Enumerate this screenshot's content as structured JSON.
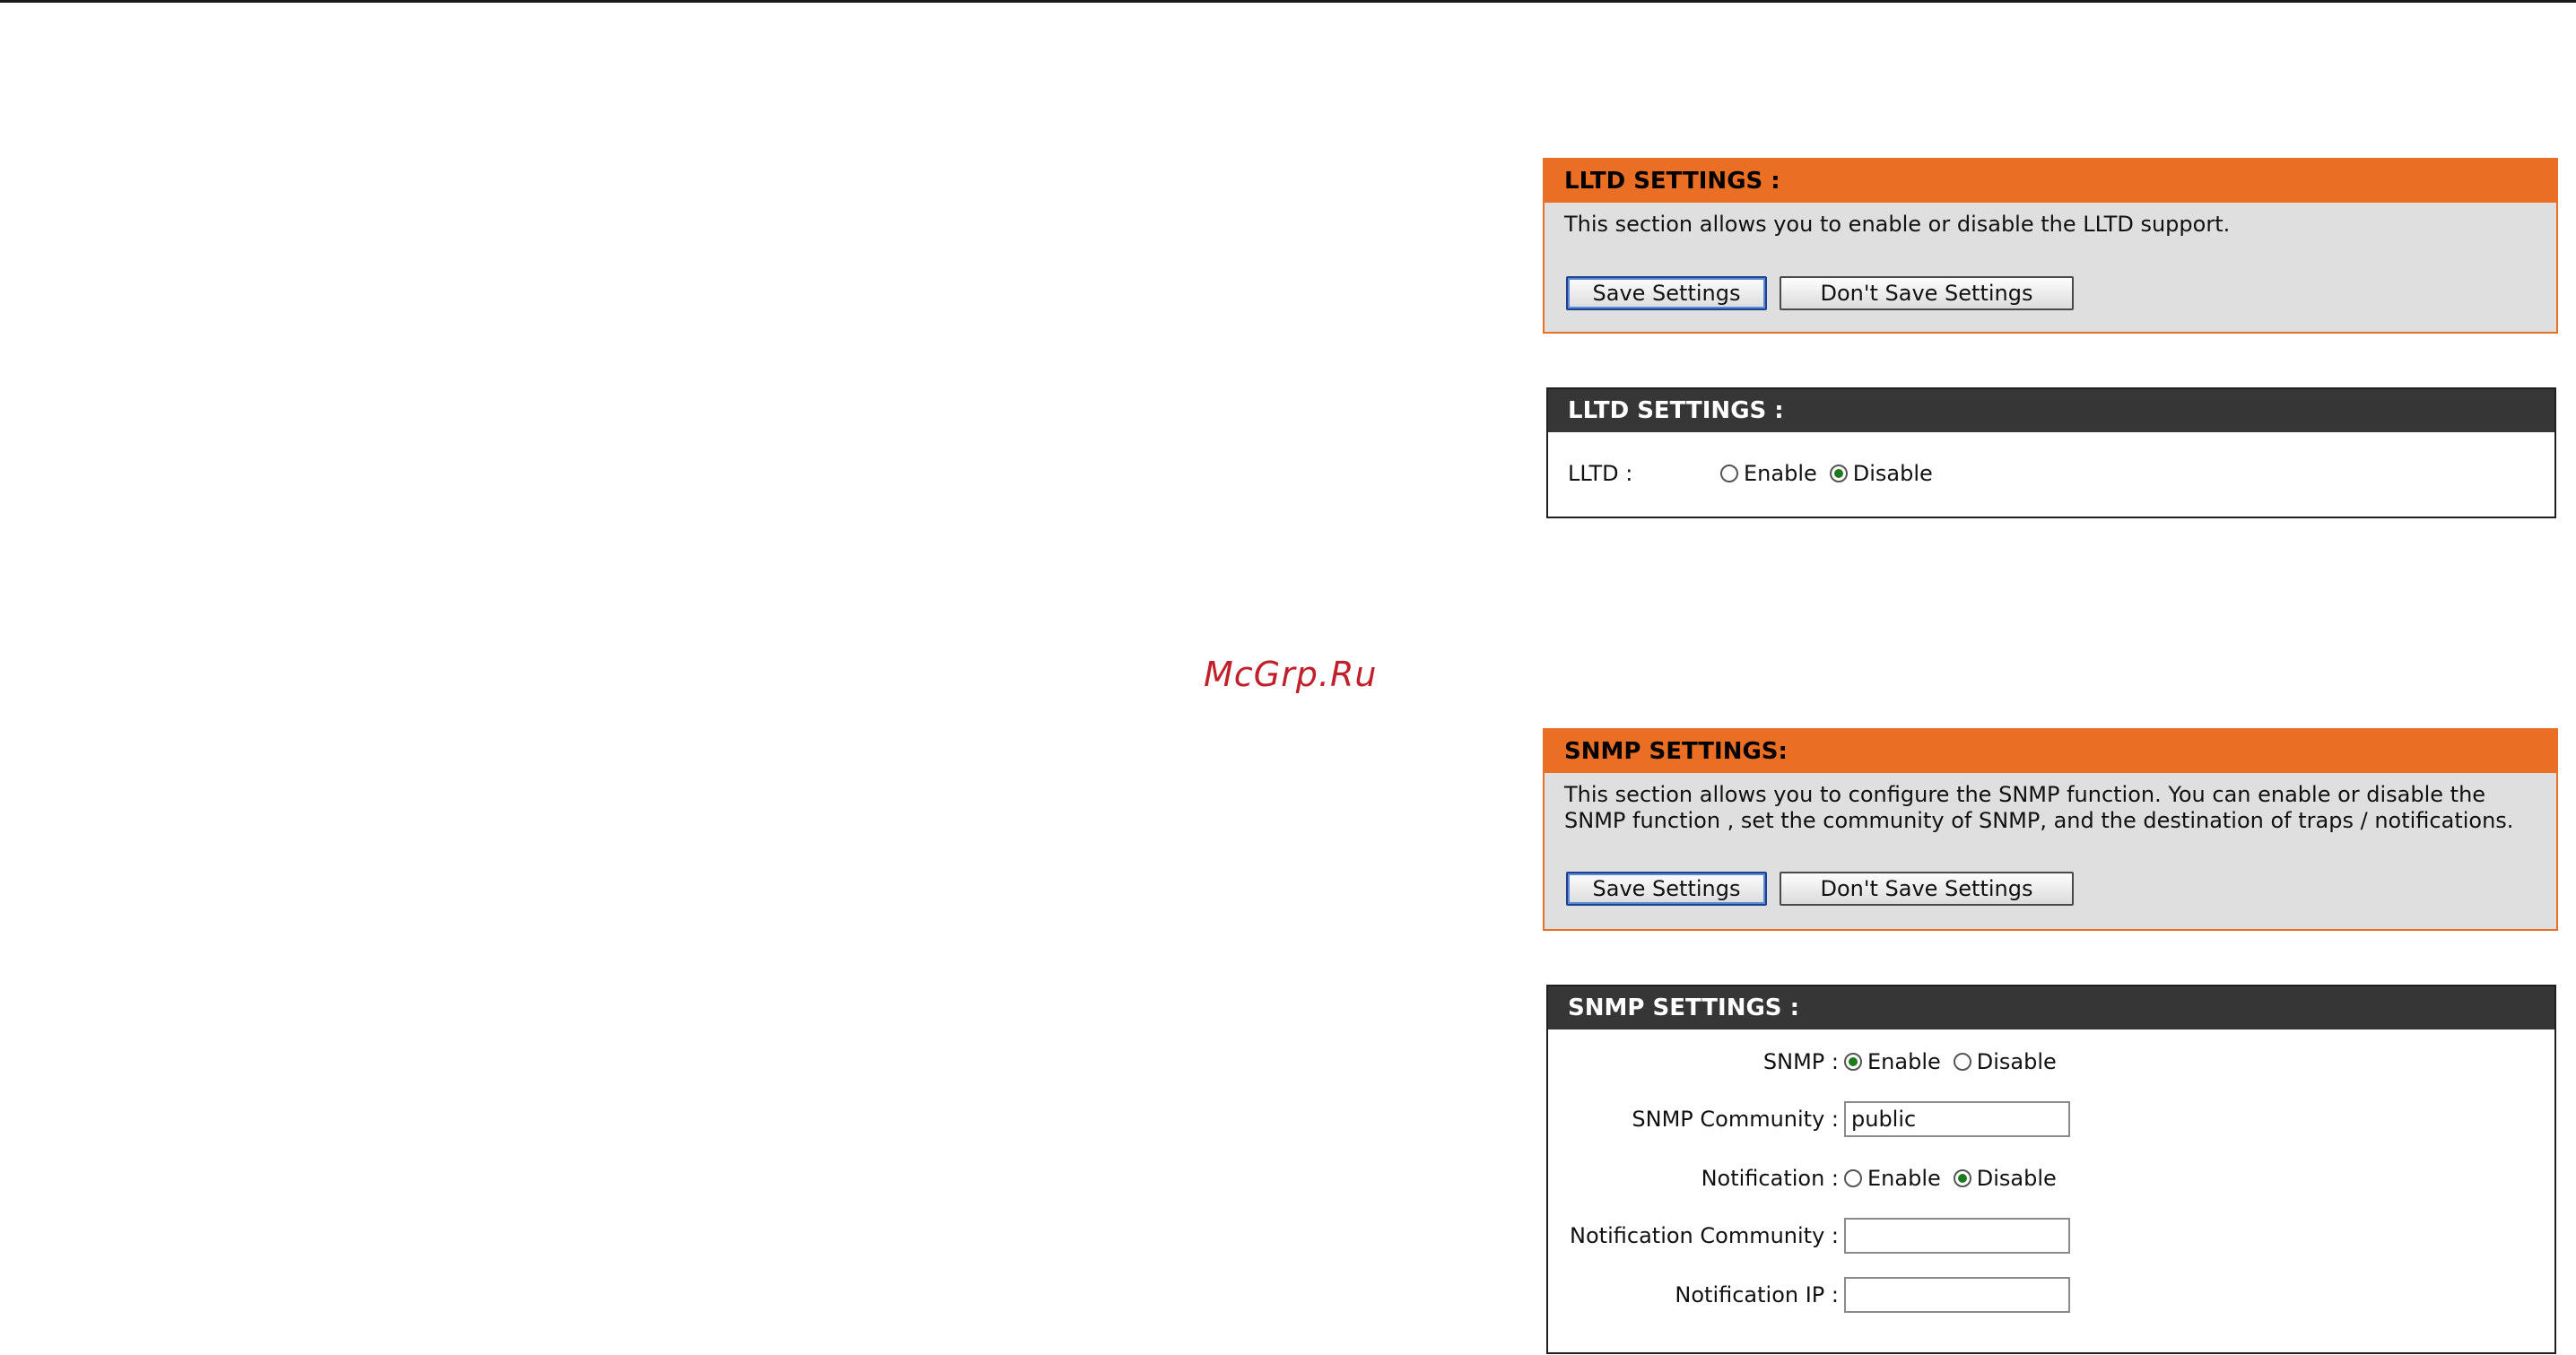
{
  "watermark": "McGrp.Ru",
  "lltd_action": {
    "title": "LLTD SETTINGS :",
    "description": "This section allows you to enable or disable the LLTD support.",
    "save_label": "Save Settings",
    "dont_save_label": "Don't Save Settings"
  },
  "lltd_form": {
    "title": "LLTD SETTINGS :",
    "lltd_label": "LLTD :",
    "enable_label": "Enable",
    "disable_label": "Disable",
    "selected": "Disable"
  },
  "snmp_action": {
    "title": "SNMP SETTINGS:",
    "description": "This section allows you to configure the SNMP function. You can enable or disable the SNMP function , set the community of SNMP, and the destination of traps / notifications.",
    "save_label": "Save Settings",
    "dont_save_label": "Don't Save Settings"
  },
  "snmp_form": {
    "title": "SNMP SETTINGS :",
    "snmp_label": "SNMP :",
    "snmp_enable_label": "Enable",
    "snmp_disable_label": "Disable",
    "snmp_selected": "Enable",
    "community_label": "SNMP Community :",
    "community_value": "public",
    "notification_label": "Notification :",
    "notification_enable_label": "Enable",
    "notification_disable_label": "Disable",
    "notification_selected": "Disable",
    "notification_community_label": "Notification Community :",
    "notification_community_value": "",
    "notification_ip_label": "Notification IP :",
    "notification_ip_value": ""
  },
  "colors": {
    "accent_orange": "#ea6f24",
    "header_dark": "#363636",
    "panel_grey": "#dfdfdf",
    "watermark_red": "#c0202a"
  }
}
